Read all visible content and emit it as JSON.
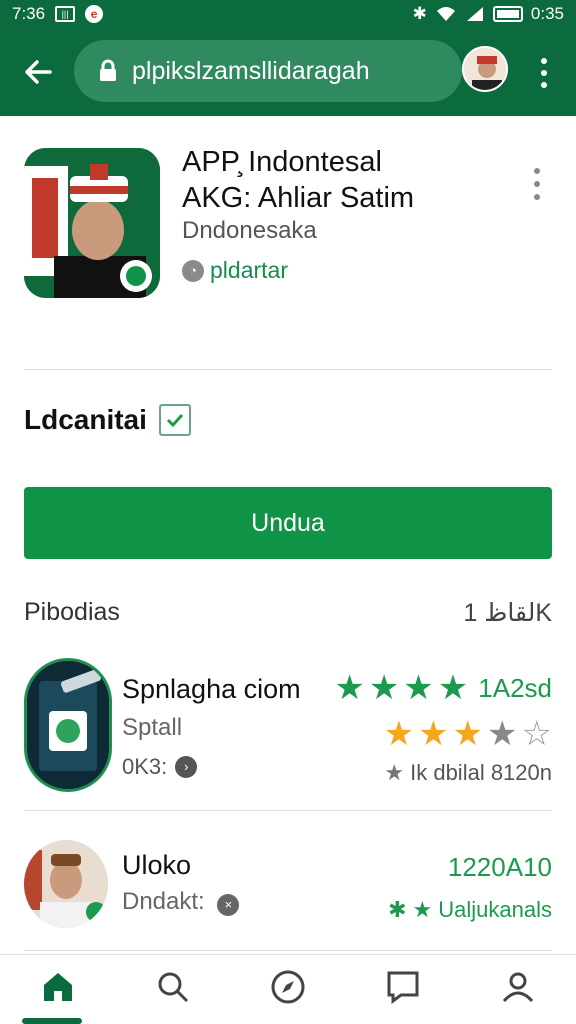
{
  "status": {
    "left_time": "7:36",
    "right_time": "0:35"
  },
  "browser": {
    "url": "plpikslzamsllidaragah"
  },
  "app": {
    "title_line1": "APP̧ Indontesal",
    "title_line2": "AKG: Ahliar Satim",
    "developer": "Dndonesaka",
    "category": "pldartar",
    "verified_label": "Ldcanitai",
    "install_label": "Undua"
  },
  "section": {
    "left": "Pibodias",
    "right": "لقاظ 1K"
  },
  "items": [
    {
      "title": "Spnlagha ciom",
      "subtitle": "Sptall",
      "meta": "0K3:",
      "rating": "1A2sd",
      "stars_green": 4,
      "stars_orange": 3,
      "detail": "Ik dbilal 8120n"
    },
    {
      "title": "Uloko",
      "subtitle": "Dndakt:",
      "rating": "1220A10",
      "detail": "Ualjukanals"
    }
  ],
  "colors": {
    "primary": "#0b6b3f",
    "accent": "#0f9447",
    "star_green": "#1c9a4e",
    "star_orange": "#f4a61c"
  },
  "icons": [
    "back-arrow-icon",
    "lock-icon",
    "more-vert-icon",
    "home-icon",
    "search-icon",
    "compass-icon",
    "chat-icon",
    "profile-icon"
  ]
}
